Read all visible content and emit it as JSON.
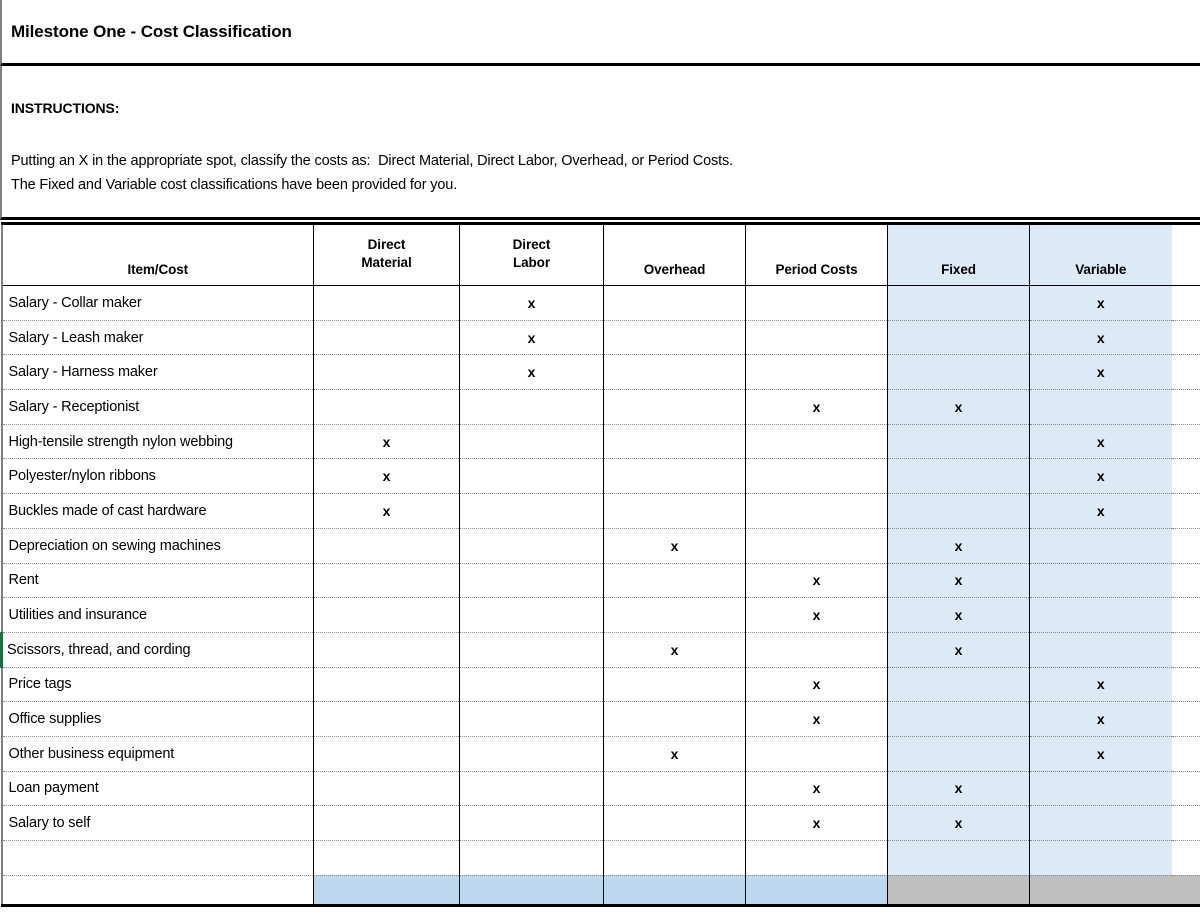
{
  "document": {
    "title": "Milestone One - Cost Classification",
    "instructions_heading": "INSTRUCTIONS:",
    "instructions_line1": "Putting an X in the appropriate spot, classify the costs as:  Direct Material, Direct Labor, Overhead, or Period Costs.",
    "instructions_line2": "The Fixed and Variable cost classifications have been provided for you."
  },
  "colors": {
    "highlight_column": "#dce9f6",
    "footer_blue": "#bdd7ee",
    "footer_gray": "#bfbfbf",
    "grid_line": "#000000",
    "row_line": "#8a8a8a",
    "change_marker": "#1e7145"
  },
  "table": {
    "headers": [
      {
        "line1": "",
        "line2": "Item/Cost"
      },
      {
        "line1": "Direct",
        "line2": "Material"
      },
      {
        "line1": "Direct",
        "line2": "Labor"
      },
      {
        "line1": "",
        "line2": "Overhead"
      },
      {
        "line1": "",
        "line2": "Period Costs"
      },
      {
        "line1": "",
        "line2": "Fixed"
      },
      {
        "line1": "",
        "line2": "Variable"
      }
    ],
    "mark": "x",
    "rows": [
      {
        "item": "Salary - Collar maker",
        "direct_material": "",
        "direct_labor": "x",
        "overhead": "",
        "period_costs": "",
        "fixed": "",
        "variable": "x"
      },
      {
        "item": "Salary - Leash maker",
        "direct_material": "",
        "direct_labor": "x",
        "overhead": "",
        "period_costs": "",
        "fixed": "",
        "variable": "x"
      },
      {
        "item": "Salary - Harness maker",
        "direct_material": "",
        "direct_labor": "x",
        "overhead": "",
        "period_costs": "",
        "fixed": "",
        "variable": "x"
      },
      {
        "item": "Salary - Receptionist",
        "direct_material": "",
        "direct_labor": "",
        "overhead": "",
        "period_costs": "x",
        "fixed": "x",
        "variable": ""
      },
      {
        "item": "High-tensile strength nylon webbing",
        "direct_material": "x",
        "direct_labor": "",
        "overhead": "",
        "period_costs": "",
        "fixed": "",
        "variable": "x"
      },
      {
        "item": "Polyester/nylon ribbons",
        "direct_material": "x",
        "direct_labor": "",
        "overhead": "",
        "period_costs": "",
        "fixed": "",
        "variable": "x"
      },
      {
        "item": "Buckles made of cast hardware",
        "direct_material": "x",
        "direct_labor": "",
        "overhead": "",
        "period_costs": "",
        "fixed": "",
        "variable": "x"
      },
      {
        "item": "Depreciation on sewing machines",
        "direct_material": "",
        "direct_labor": "",
        "overhead": "x",
        "period_costs": "",
        "fixed": "x",
        "variable": ""
      },
      {
        "item": "Rent",
        "direct_material": "",
        "direct_labor": "",
        "overhead": "",
        "period_costs": "x",
        "fixed": "x",
        "variable": ""
      },
      {
        "item": "Utilities and insurance",
        "direct_material": "",
        "direct_labor": "",
        "overhead": "",
        "period_costs": "x",
        "fixed": "x",
        "variable": ""
      },
      {
        "item": "Scissors, thread, and cording",
        "direct_material": "",
        "direct_labor": "",
        "overhead": "x",
        "period_costs": "",
        "fixed": "x",
        "variable": "",
        "flagged": true
      },
      {
        "item": "Price tags",
        "direct_material": "",
        "direct_labor": "",
        "overhead": "",
        "period_costs": "x",
        "fixed": "",
        "variable": "x"
      },
      {
        "item": "Office supplies",
        "direct_material": "",
        "direct_labor": "",
        "overhead": "",
        "period_costs": "x",
        "fixed": "",
        "variable": "x"
      },
      {
        "item": "Other business equipment",
        "direct_material": "",
        "direct_labor": "",
        "overhead": "x",
        "period_costs": "",
        "fixed": "",
        "variable": "x"
      },
      {
        "item": "Loan payment",
        "direct_material": "",
        "direct_labor": "",
        "overhead": "",
        "period_costs": "x",
        "fixed": "x",
        "variable": ""
      },
      {
        "item": "Salary to self",
        "direct_material": "",
        "direct_labor": "",
        "overhead": "",
        "period_costs": "x",
        "fixed": "x",
        "variable": ""
      },
      {
        "item": "",
        "direct_material": "",
        "direct_labor": "",
        "overhead": "",
        "period_costs": "",
        "fixed": "",
        "variable": ""
      }
    ],
    "footer": {
      "item": "",
      "direct_material": "",
      "direct_labor": "",
      "overhead": "",
      "period_costs": "",
      "fixed": "",
      "variable": ""
    }
  }
}
